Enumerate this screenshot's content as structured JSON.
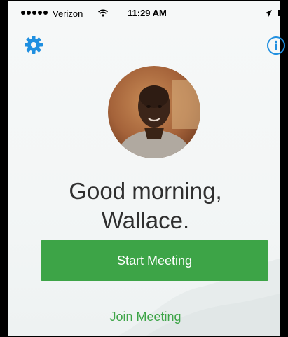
{
  "status_bar": {
    "carrier": "Verizon",
    "time": "11:29 AM",
    "signal_icon": "cellular-signal-icon",
    "wifi_icon": "wifi-icon",
    "location_icon": "location-arrow-icon",
    "battery_icon": "battery-icon"
  },
  "toolbar": {
    "settings_icon": "gear-icon",
    "info_icon": "info-icon"
  },
  "profile": {
    "avatar": "user-avatar-photo"
  },
  "greeting": {
    "line1": "Good morning,",
    "line2": "Wallace."
  },
  "actions": {
    "start_meeting": "Start Meeting",
    "join_meeting": "Join Meeting"
  },
  "colors": {
    "accent_green": "#3da447",
    "accent_blue": "#1f8fe0",
    "text_dark": "#2f2f2f"
  }
}
